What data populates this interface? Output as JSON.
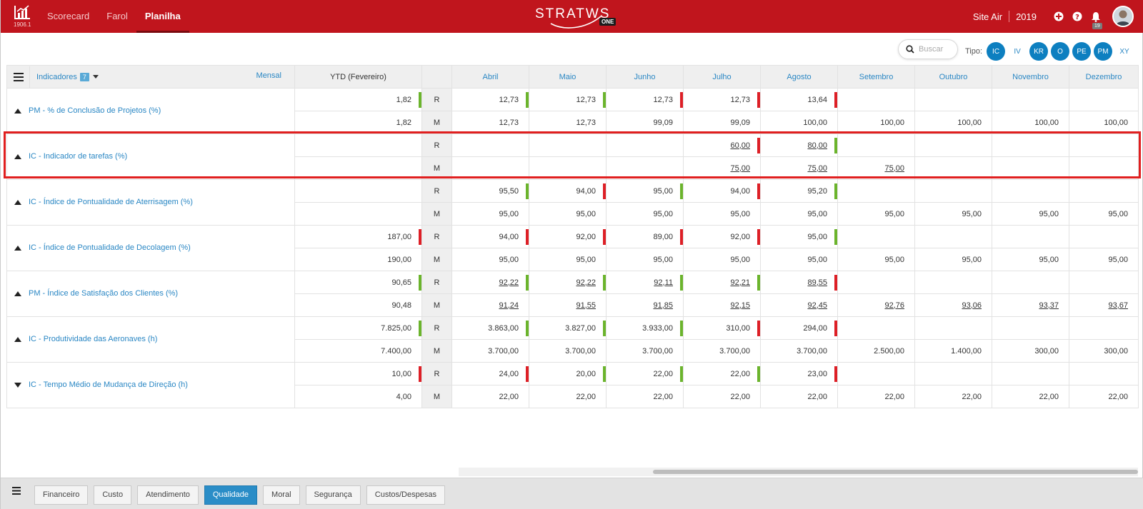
{
  "topbar": {
    "logo_version": "1906.1",
    "nav": [
      "Scorecard",
      "Farol",
      "Planilha"
    ],
    "active_nav": "Planilha",
    "brand": "STRATWS",
    "brand_badge": "ONE",
    "org": "Site Air",
    "year": "2019",
    "notification_count": "19",
    "icons": [
      "add-icon",
      "help-icon",
      "bell-icon"
    ]
  },
  "toolbar": {
    "search_placeholder": "Buscar",
    "tipo_label": "Tipo:",
    "tipo_chips": [
      {
        "label": "IC",
        "active": true
      },
      {
        "label": "IV",
        "active": false
      },
      {
        "label": "KR",
        "active": true
      },
      {
        "label": "O",
        "active": true
      },
      {
        "label": "PE",
        "active": true
      },
      {
        "label": "PM",
        "active": true
      },
      {
        "label": "XY",
        "active": false
      }
    ]
  },
  "table": {
    "indicadores_label": "Indicadores",
    "indicadores_count": "7",
    "period_label": "Mensal",
    "ytd_label": "YTD (Fevereiro)",
    "months": [
      "Abril",
      "Maio",
      "Junho",
      "Julho",
      "Agosto",
      "Setembro",
      "Outubro",
      "Novembro",
      "Dezembro"
    ],
    "rows": [
      {
        "name": "PM - % de Conclusão de Projetos (%)",
        "direction": "up",
        "R": {
          "ytd": "1,82",
          "ytd_flag": "g",
          "vals": [
            "12,73",
            "12,73",
            "12,73",
            "12,73",
            "13,64",
            "",
            "",
            "",
            ""
          ],
          "flags": [
            "g",
            "g",
            "r",
            "r",
            "r",
            "",
            "",
            "",
            ""
          ],
          "underline": false
        },
        "M": {
          "ytd": "1,82",
          "ytd_flag": "",
          "vals": [
            "12,73",
            "12,73",
            "99,09",
            "99,09",
            "100,00",
            "100,00",
            "100,00",
            "100,00",
            "100,00"
          ],
          "flags": [
            "",
            "",
            "",
            "",
            "",
            "",
            "",
            "",
            ""
          ],
          "underline": false
        }
      },
      {
        "name": "IC - Indicador de tarefas (%)",
        "direction": "up",
        "R": {
          "ytd": "",
          "ytd_flag": "",
          "vals": [
            "",
            "",
            "",
            "60,00",
            "80,00",
            "",
            "",
            "",
            ""
          ],
          "flags": [
            "",
            "",
            "",
            "r",
            "g",
            "",
            "",
            "",
            ""
          ],
          "underline": true
        },
        "M": {
          "ytd": "",
          "ytd_flag": "",
          "vals": [
            "",
            "",
            "",
            "75,00",
            "75,00",
            "75,00",
            "",
            "",
            ""
          ],
          "flags": [
            "",
            "",
            "",
            "",
            "",
            "",
            "",
            "",
            ""
          ],
          "underline": true
        }
      },
      {
        "name": "IC - Índice de Pontualidade de Aterrisagem (%)",
        "direction": "up",
        "R": {
          "ytd": "",
          "ytd_flag": "",
          "vals": [
            "95,50",
            "94,00",
            "95,00",
            "94,00",
            "95,20",
            "",
            "",
            "",
            ""
          ],
          "flags": [
            "g",
            "r",
            "g",
            "r",
            "g",
            "",
            "",
            "",
            ""
          ],
          "underline": false
        },
        "M": {
          "ytd": "",
          "ytd_flag": "",
          "vals": [
            "95,00",
            "95,00",
            "95,00",
            "95,00",
            "95,00",
            "95,00",
            "95,00",
            "95,00",
            "95,00"
          ],
          "flags": [
            "",
            "",
            "",
            "",
            "",
            "",
            "",
            "",
            ""
          ],
          "underline": false
        }
      },
      {
        "name": "IC - Índice de Pontualidade de Decolagem (%)",
        "direction": "up",
        "R": {
          "ytd": "187,00",
          "ytd_flag": "r",
          "vals": [
            "94,00",
            "92,00",
            "89,00",
            "92,00",
            "95,00",
            "",
            "",
            "",
            ""
          ],
          "flags": [
            "r",
            "r",
            "r",
            "r",
            "g",
            "",
            "",
            "",
            ""
          ],
          "underline": false
        },
        "M": {
          "ytd": "190,00",
          "ytd_flag": "",
          "vals": [
            "95,00",
            "95,00",
            "95,00",
            "95,00",
            "95,00",
            "95,00",
            "95,00",
            "95,00",
            "95,00"
          ],
          "flags": [
            "",
            "",
            "",
            "",
            "",
            "",
            "",
            "",
            ""
          ],
          "underline": false
        }
      },
      {
        "name": "PM - Índice de Satisfação dos Clientes (%)",
        "direction": "up",
        "R": {
          "ytd": "90,65",
          "ytd_flag": "g",
          "vals": [
            "92,22",
            "92,22",
            "92,11",
            "92,21",
            "89,55",
            "",
            "",
            "",
            ""
          ],
          "flags": [
            "g",
            "g",
            "g",
            "g",
            "r",
            "",
            "",
            "",
            ""
          ],
          "underline": true
        },
        "M": {
          "ytd": "90,48",
          "ytd_flag": "",
          "vals": [
            "91,24",
            "91,55",
            "91,85",
            "92,15",
            "92,45",
            "92,76",
            "93,06",
            "93,37",
            "93,67"
          ],
          "flags": [
            "",
            "",
            "",
            "",
            "",
            "",
            "",
            "",
            ""
          ],
          "underline": true
        }
      },
      {
        "name": "IC - Produtividade das Aeronaves (h)",
        "direction": "up",
        "R": {
          "ytd": "7.825,00",
          "ytd_flag": "g",
          "vals": [
            "3.863,00",
            "3.827,00",
            "3.933,00",
            "310,00",
            "294,00",
            "",
            "",
            "",
            ""
          ],
          "flags": [
            "g",
            "g",
            "g",
            "r",
            "r",
            "",
            "",
            "",
            ""
          ],
          "underline": false
        },
        "M": {
          "ytd": "7.400,00",
          "ytd_flag": "",
          "vals": [
            "3.700,00",
            "3.700,00",
            "3.700,00",
            "3.700,00",
            "3.700,00",
            "2.500,00",
            "1.400,00",
            "300,00",
            "300,00"
          ],
          "flags": [
            "",
            "",
            "",
            "",
            "",
            "",
            "",
            "",
            ""
          ],
          "underline": false
        }
      },
      {
        "name": "IC - Tempo Médio de Mudança de Direção (h)",
        "direction": "down",
        "R": {
          "ytd": "10,00",
          "ytd_flag": "r",
          "vals": [
            "24,00",
            "20,00",
            "22,00",
            "22,00",
            "23,00",
            "",
            "",
            "",
            ""
          ],
          "flags": [
            "r",
            "g",
            "g",
            "g",
            "r",
            "",
            "",
            "",
            ""
          ],
          "underline": false
        },
        "M": {
          "ytd": "4,00",
          "ytd_flag": "",
          "vals": [
            "22,00",
            "22,00",
            "22,00",
            "22,00",
            "22,00",
            "22,00",
            "22,00",
            "22,00",
            "22,00"
          ],
          "flags": [
            "",
            "",
            "",
            "",
            "",
            "",
            "",
            "",
            ""
          ],
          "underline": false
        }
      }
    ]
  },
  "bottom_tabs": [
    "Financeiro",
    "Custo",
    "Atendimento",
    "Qualidade",
    "Moral",
    "Segurança",
    "Custos/Despesas"
  ],
  "active_tab": "Qualidade",
  "colors": {
    "topbar": "#c0151d",
    "accent": "#2a87c4",
    "flag_green": "#6bb42c",
    "flag_red": "#dd1f26",
    "highlight": "#e01f1f"
  }
}
